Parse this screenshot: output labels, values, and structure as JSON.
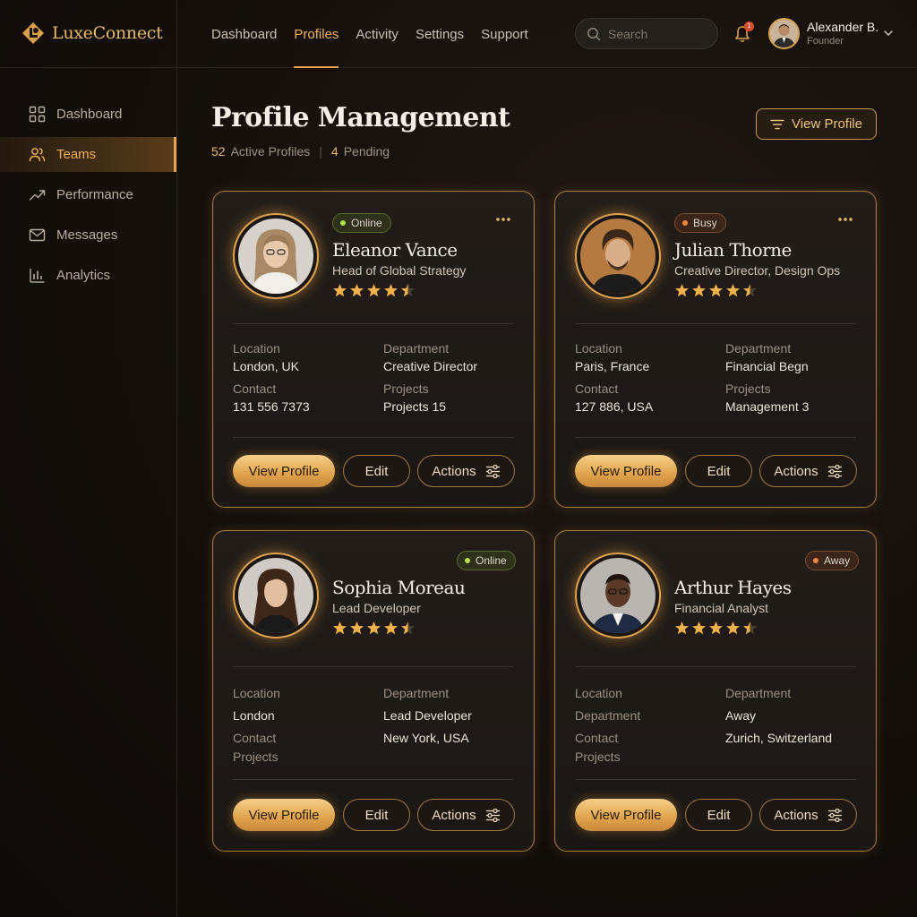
{
  "brand": {
    "name": "LuxeConnect"
  },
  "topnav": [
    {
      "label": "Dashboard"
    },
    {
      "label": "Profiles"
    },
    {
      "label": "Activity"
    },
    {
      "label": "Settings"
    },
    {
      "label": "Support"
    }
  ],
  "search": {
    "placeholder": "Search"
  },
  "notifications": {
    "count": "1"
  },
  "user": {
    "name": "Alexander B.",
    "role": "Founder"
  },
  "sidebar": {
    "items": [
      {
        "label": "Dashboard",
        "icon": "grid-icon"
      },
      {
        "label": "Teams",
        "icon": "users-icon"
      },
      {
        "label": "Performance",
        "icon": "trending-up-icon"
      },
      {
        "label": "Messages",
        "icon": "mail-icon"
      },
      {
        "label": "Analytics",
        "icon": "bar-chart-icon"
      }
    ]
  },
  "header": {
    "title": "Profile Management",
    "active_count": "52",
    "active_label": "Active Profiles",
    "pending_count": "4",
    "pending_label": "Pending",
    "button_label": "View Profile"
  },
  "colors": {
    "accent": "#e6a54c",
    "gold": "#f0b257",
    "online": "#b7e04a",
    "busy": "#f08a3c"
  },
  "buttons": {
    "view": "View Profile",
    "edit": "Edit",
    "actions": "Actions"
  },
  "profiles": [
    {
      "name": "Eleanor Vance",
      "title": "Head of Global Strategy",
      "status": "Online",
      "rating": 4.5,
      "fields": {
        "l1": "Location",
        "v1": "London, UK",
        "l2": "Department",
        "v2": "Creative Director",
        "l3": "Contact",
        "v3": "131 556 7373",
        "l4": "Projects",
        "v4": "Projects 15"
      }
    },
    {
      "name": "Julian Thorne",
      "title": "Creative Director, Design Ops",
      "status": "Busy",
      "rating": 4.5,
      "fields": {
        "l1": "Location",
        "v1": "Paris, France",
        "l2": "Department",
        "v2": "Financial Begn",
        "l3": "Contact",
        "v3": "127 886, USA",
        "l4": "Projects",
        "v4": "Management 3"
      }
    },
    {
      "name": "Sophia Moreau",
      "title": "Lead Developer",
      "status": "Online",
      "rating": 4.5,
      "fields": {
        "l1": "Location",
        "v1": "London",
        "l2": "Department",
        "v2": "Lead Developer",
        "l3": "Contact",
        "v3": "New York, USA",
        "l4": "Projects"
      }
    },
    {
      "name": "Arthur Hayes",
      "title": "Financial Analyst",
      "status": "Away",
      "rating": 4.5,
      "fields": {
        "l1": "Location",
        "v1": "Department",
        "l2": "Department",
        "v2": "Away",
        "l3": "Contact",
        "v3": "Zurich, Switzerland",
        "l4": "Projects"
      }
    }
  ]
}
